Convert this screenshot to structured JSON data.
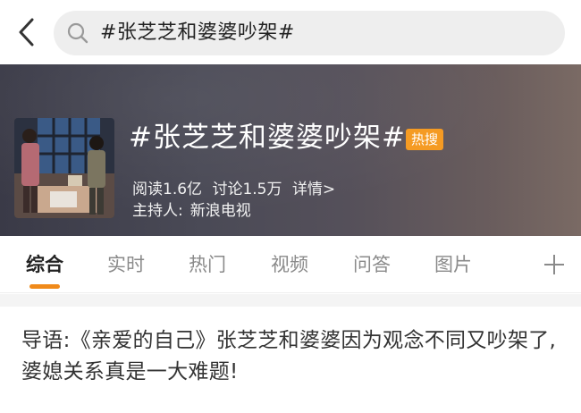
{
  "search": {
    "query": "#张芝芝和婆婆吵架#"
  },
  "topic": {
    "title": "#张芝芝和婆婆吵架#",
    "badge": "热搜",
    "reads": "阅读1.6亿",
    "discussions": "讨论1.5万",
    "details": "详情>",
    "host_label": "主持人:",
    "host_name": "新浪电视"
  },
  "tabs": [
    {
      "label": "综合",
      "active": true
    },
    {
      "label": "实时",
      "active": false
    },
    {
      "label": "热门",
      "active": false
    },
    {
      "label": "视频",
      "active": false
    },
    {
      "label": "问答",
      "active": false
    },
    {
      "label": "图片",
      "active": false
    }
  ],
  "intro": {
    "text": "导语:《亲爱的自己》张芝芝和婆婆因为观念不同又吵架了,婆媳关系真是一大难题!"
  },
  "colors": {
    "accent": "#f08a1a",
    "badge": "#f59b23"
  },
  "icons": [
    "back-arrow-icon",
    "search-icon",
    "plus-icon"
  ]
}
